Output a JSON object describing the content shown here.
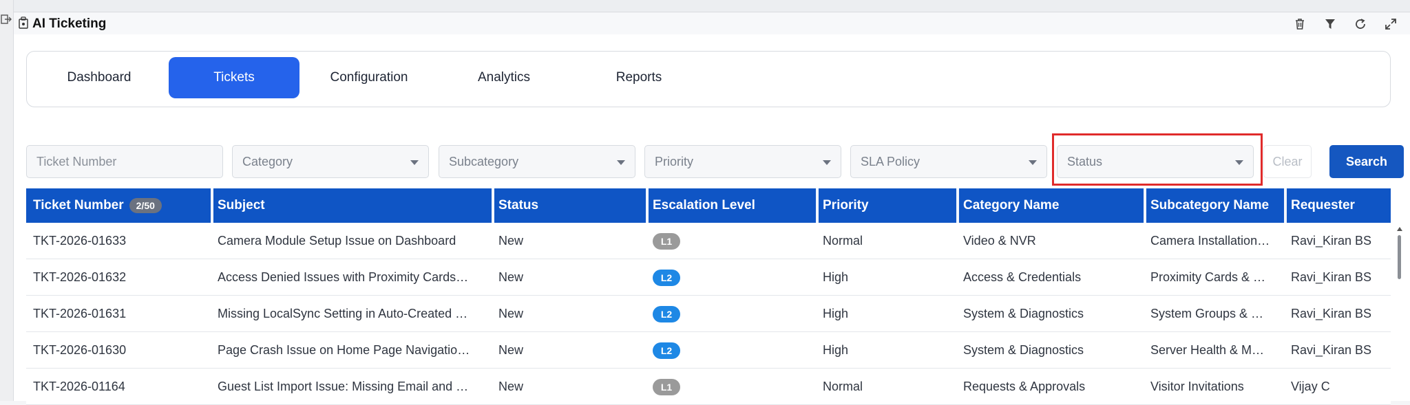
{
  "window": {
    "title": "AI Ticketing"
  },
  "toolbar": {
    "icons": [
      "trash-icon",
      "filter-icon",
      "refresh-icon",
      "expand-icon"
    ]
  },
  "tabs": [
    {
      "label": "Dashboard",
      "active": false
    },
    {
      "label": "Tickets",
      "active": true
    },
    {
      "label": "Configuration",
      "active": false
    },
    {
      "label": "Analytics",
      "active": false
    },
    {
      "label": "Reports",
      "active": false
    }
  ],
  "filters": {
    "ticket_number_placeholder": "Ticket Number",
    "category": "Category",
    "subcategory": "Subcategory",
    "priority": "Priority",
    "sla_policy": "SLA Policy",
    "status": "Status",
    "clear_label": "Clear",
    "search_label": "Search"
  },
  "table": {
    "count": "2/50",
    "columns": [
      "Ticket Number",
      "Subject",
      "Status",
      "Escalation Level",
      "Priority",
      "Category Name",
      "Subcategory Name",
      "Requester"
    ],
    "rows": [
      {
        "ticket": "TKT-2026-01633",
        "subject": "Camera Module Setup Issue on Dashboard",
        "status": "New",
        "level": "L1",
        "priority": "Normal",
        "category": "Video & NVR",
        "subcategory": "Camera Installation…",
        "requester": "Ravi_Kiran BS"
      },
      {
        "ticket": "TKT-2026-01632",
        "subject": "Access Denied Issues with Proximity Cards…",
        "status": "New",
        "level": "L2",
        "priority": "High",
        "category": "Access & Credentials",
        "subcategory": "Proximity Cards & …",
        "requester": "Ravi_Kiran BS"
      },
      {
        "ticket": "TKT-2026-01631",
        "subject": "Missing LocalSync Setting in Auto-Created …",
        "status": "New",
        "level": "L2",
        "priority": "High",
        "category": "System & Diagnostics",
        "subcategory": "System Groups & …",
        "requester": "Ravi_Kiran BS"
      },
      {
        "ticket": "TKT-2026-01630",
        "subject": "Page Crash Issue on Home Page Navigatio…",
        "status": "New",
        "level": "L2",
        "priority": "High",
        "category": "System & Diagnostics",
        "subcategory": "Server Health & M…",
        "requester": "Ravi_Kiran BS"
      },
      {
        "ticket": "TKT-2026-01164",
        "subject": "Guest List Import Issue: Missing Email and …",
        "status": "New",
        "level": "L1",
        "priority": "Normal",
        "category": "Requests & Approvals",
        "subcategory": "Visitor Invitations",
        "requester": "Vijay C"
      }
    ]
  },
  "colors": {
    "accent": "#2563eb",
    "header": "#0f55c5",
    "level_l1": "#9a9a9a",
    "level_l2": "#1e88e5",
    "highlight": "#e02b2b"
  }
}
